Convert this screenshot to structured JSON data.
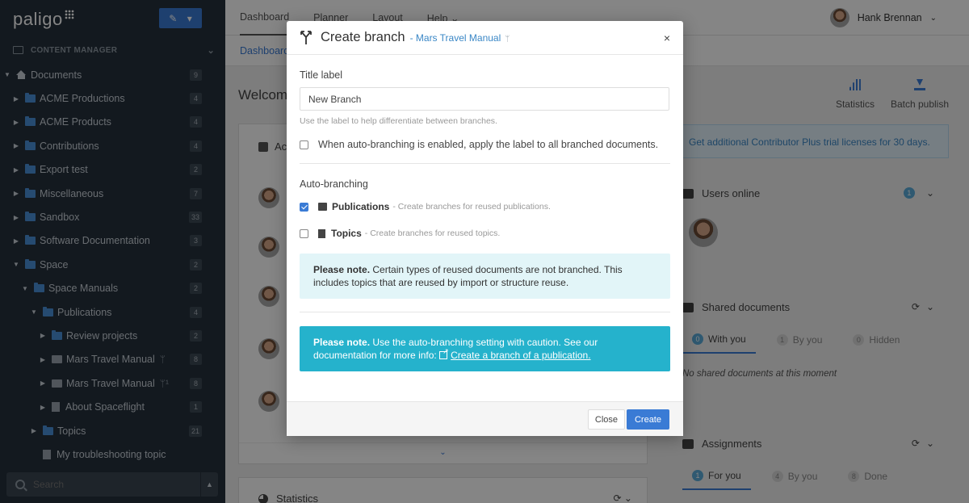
{
  "app": {
    "logo": "paligo",
    "new_button": "▾"
  },
  "sidebar": {
    "section_label": "CONTENT MANAGER",
    "tree": [
      {
        "label": "Documents",
        "count": "9",
        "indent": 0,
        "expanded": true,
        "type": "home"
      },
      {
        "label": "ACME Productions",
        "count": "4",
        "indent": 1,
        "type": "folder"
      },
      {
        "label": "ACME Products",
        "count": "4",
        "indent": 1,
        "type": "folder"
      },
      {
        "label": "Contributions",
        "count": "4",
        "indent": 1,
        "type": "folder"
      },
      {
        "label": "Export test",
        "count": "2",
        "indent": 1,
        "type": "folder"
      },
      {
        "label": "Miscellaneous",
        "count": "7",
        "indent": 1,
        "type": "folder"
      },
      {
        "label": "Sandbox",
        "count": "33",
        "indent": 1,
        "type": "folder"
      },
      {
        "label": "Software Documentation",
        "count": "3",
        "indent": 1,
        "type": "folder"
      },
      {
        "label": "Space",
        "count": "2",
        "indent": 1,
        "expanded": true,
        "type": "folder"
      },
      {
        "label": "Space Manuals",
        "count": "2",
        "indent": 2,
        "expanded": true,
        "type": "folder"
      },
      {
        "label": "Publications",
        "count": "4",
        "indent": 3,
        "expanded": true,
        "type": "folder"
      },
      {
        "label": "Review projects",
        "count": "2",
        "indent": 4,
        "type": "folder"
      },
      {
        "label": "Mars Travel Manual",
        "count": "8",
        "indent": 4,
        "type": "pub",
        "branch": "ᛘ"
      },
      {
        "label": "Mars Travel Manual",
        "count": "8",
        "indent": 4,
        "type": "pub",
        "branch": "ᛘ¹"
      },
      {
        "label": "About Spaceflight",
        "count": "1",
        "indent": 4,
        "type": "doc"
      },
      {
        "label": "Topics",
        "count": "21",
        "indent": 3,
        "type": "folder"
      },
      {
        "label": "My troubleshooting topic",
        "count": "",
        "indent": 3,
        "type": "doc",
        "noarrow": true
      }
    ],
    "search_placeholder": "Search"
  },
  "topnav": {
    "tabs": [
      "Dashboard",
      "Planner",
      "Layout",
      "Help ⌄"
    ],
    "user_name": "Hank Brennan"
  },
  "subnav": {
    "crumb": "Dashboard"
  },
  "welcome": "Welcome",
  "actions": {
    "statistics": "Statistics",
    "batch_publish": "Batch publish"
  },
  "activity": {
    "header": "Ac"
  },
  "statistics_panel": {
    "header": "Statistics"
  },
  "trial_alert": "Get additional Contributor Plus trial licenses for 30 days.",
  "users_online": {
    "header": "Users online",
    "count": "1"
  },
  "shared_documents": {
    "header": "Shared documents",
    "tabs": [
      {
        "label": "With you",
        "count": "0"
      },
      {
        "label": "By you",
        "count": "1"
      },
      {
        "label": "Hidden",
        "count": "0"
      }
    ],
    "empty": "No shared documents at this moment"
  },
  "assignments": {
    "header": "Assignments",
    "tabs": [
      {
        "label": "For you",
        "count": "1"
      },
      {
        "label": "By you",
        "count": "4"
      },
      {
        "label": "Done",
        "count": "8"
      }
    ]
  },
  "modal": {
    "title": "Create branch",
    "subtitle": "- Mars Travel Manual",
    "subtitle_mark": "ᛘ",
    "close_glyph": "×",
    "title_label": "Title label",
    "title_value": "New Branch",
    "title_hint": "Use the label to help differentiate between branches.",
    "apply_label": "When auto-branching is enabled, apply the label to all branched documents.",
    "auto_title": "Auto-branching",
    "publications_name": "Publications",
    "publications_desc": "- Create branches for reused publications.",
    "topics_name": "Topics",
    "topics_desc": "- Create branches for reused topics.",
    "note1_bold": "Please note.",
    "note1_text": " Certain types of reused documents are not branched. This includes topics that are reused by import or structure reuse.",
    "note2_bold": "Please note.",
    "note2_text": " Use the auto-branching setting with caution. See our documentation for more info: ",
    "note2_link": "Create a branch of a publication.",
    "close_button": "Close",
    "create_button": "Create"
  }
}
